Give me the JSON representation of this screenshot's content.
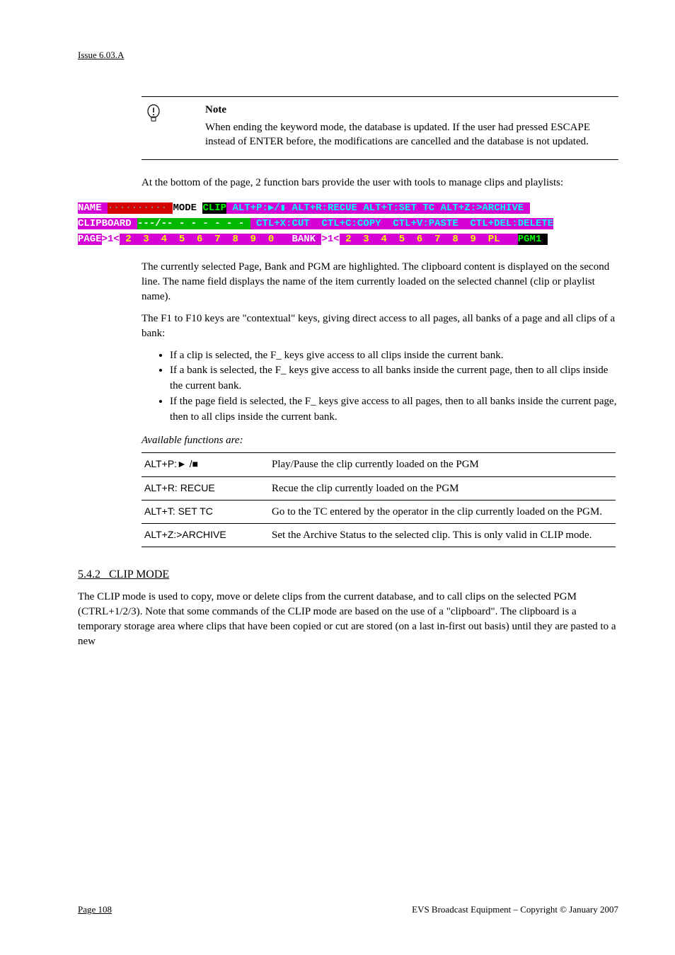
{
  "header": {
    "issue": "Issue 6.03.A"
  },
  "note": {
    "title": "Note",
    "text": "When ending the keyword mode, the database is updated. If the user had pressed ESCAPE instead of ENTER before, the modifications are cancelled and the database is not updated."
  },
  "intro": "At the bottom of the page, 2 function bars provide the user with tools to manage clips and playlists:",
  "toolbar": {
    "row1": {
      "name_label": "NAME ",
      "name_value": "·········· ",
      "mode_label": "MODE ",
      "mode_value": "CLIP",
      "altp": " ALT+P:▶/▮",
      "altr": " ALT+R:RECUE",
      "altt": " ALT+T:SET TC",
      "altz": " ALT+Z:>ARCHIVE "
    },
    "row2": {
      "clip_label": "CLIPBOARD ",
      "clip_value": "---/-- - - - - - - ",
      "ctlx": " CTL+X:CUT ",
      "ctlc": " CTL+C:COPY ",
      "ctlv": " CTL+V:PASTE ",
      "ctldel": " CTL+DEL:DELETE"
    },
    "row3": {
      "page_label": "PAGE",
      "page_sel": ">1<",
      "page_rest": " 2  3  4  5  6  7  8  9  0   ",
      "bank_label": "BANK ",
      "bank_sel": ">1<",
      "bank_rest": " 2  3  4  5  6  7  8  9  PL   ",
      "pgm": "PGM1 "
    }
  },
  "captions": {
    "selection": "The currently selected Page, Bank and PGM are highlighted. The clipboard content is displayed on the second line. The name field displays the name of the item currently loaded on the selected channel (clip or playlist name).",
    "f1f0": "The F1 to F10 keys are \"contextual\" keys, giving direct access to all pages, all banks of a page and all clips of a bank:"
  },
  "bullets": {
    "b1": "If a clip is selected, the F_ keys give access to all clips inside the current bank.",
    "b2": "If a bank is selected, the F_ keys give access to all banks inside the current page, then to all clips inside the current bank.",
    "b3": "If the page field is selected, the F_ keys give access to all pages, then to all banks inside the current page, then to all clips inside the current bank."
  },
  "table_intro": "Available functions are:",
  "table": {
    "r1": {
      "k": "ALT+P:► /■",
      "d": "Play/Pause the clip currently loaded on the PGM"
    },
    "r2": {
      "k": "ALT+R: RECUE",
      "d": "Recue the clip currently loaded on the PGM"
    },
    "r3": {
      "k": "ALT+T: SET TC",
      "d": "Go to the TC entered by the operator in the clip currently loaded on the PGM."
    },
    "r4": {
      "k": "ALT+Z:>ARCHIVE",
      "d": "Set the Archive Status to the selected clip. This is only valid in CLIP mode."
    }
  },
  "section": {
    "num": "5.4.2",
    "title": "CLIP MODE",
    "text": "The CLIP mode is used to copy, move or delete clips from the current database, and to call clips on the selected PGM (CTRL+1/2/3). Note that some commands of the CLIP mode are based on the use of a \"clipboard\". The clipboard is a temporary storage area where clips that have been copied or cut are stored (on a last in-first out basis) until they are pasted to a new"
  },
  "footer": {
    "left": "Page 108",
    "right": "EVS Broadcast Equipment – Copyright © January 2007"
  }
}
